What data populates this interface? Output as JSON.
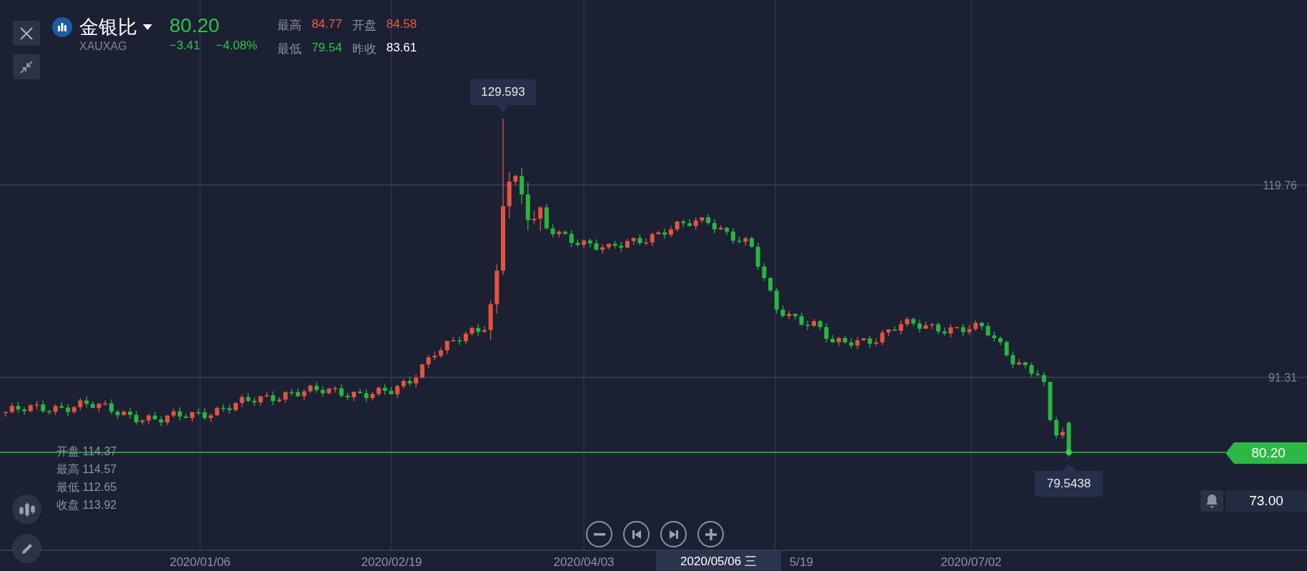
{
  "header": {
    "name": "金银比",
    "symbol": "XAUXAG",
    "price": "80.20",
    "change": "−3.41",
    "change_pct": "−4.08%",
    "color": "#31c24a",
    "stats": [
      {
        "label": "最高",
        "value": "84.77",
        "color": "#ef5b45"
      },
      {
        "label": "开盘",
        "value": "84.58",
        "color": "#ef5b45"
      },
      {
        "label": "最低",
        "value": "79.54",
        "color": "#31c24a"
      },
      {
        "label": "昨收",
        "value": "83.61",
        "color": "#ffffff"
      }
    ]
  },
  "y_axis_labels": [
    "119.76",
    "91.31"
  ],
  "x_axis_labels": [
    "2020/01/06",
    "2020/02/19",
    "2020/04/03",
    "5/19",
    "2020/07/02"
  ],
  "crosshair_date": "2020/05/06 三",
  "high_marker": "129.593",
  "low_marker": "79.5438",
  "last_price_tag": "80.20",
  "alert": {
    "value": "73.00"
  },
  "candle_info": [
    {
      "label": "开盘",
      "value": "114.37"
    },
    {
      "label": "最高",
      "value": "114.57"
    },
    {
      "label": "最低",
      "value": "112.65"
    },
    {
      "label": "收盘",
      "value": "113.92"
    }
  ]
}
